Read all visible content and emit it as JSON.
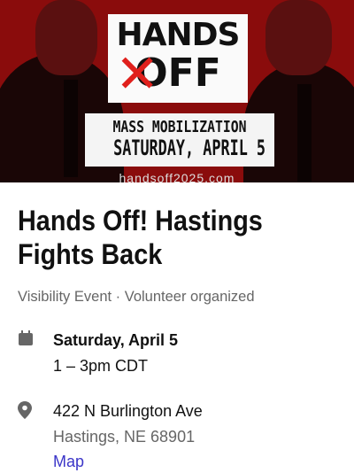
{
  "banner": {
    "heading_top": "HANDS",
    "heading_bottom": "OFF",
    "line1": "MASS MOBILIZATION",
    "line2": "SATURDAY, APRIL 5",
    "url": "handsoff2025.com"
  },
  "event": {
    "title": "Hands Off! Hastings Fights Back",
    "type": "Visibility Event",
    "separator": " · ",
    "organizer": "Volunteer organized",
    "date": "Saturday, April 5",
    "time": "1 – 3pm CDT",
    "address1": "422 N Burlington Ave",
    "address2": "Hastings, NE 68901",
    "map_link": "Map"
  },
  "icons": {
    "date": "calendar-icon",
    "location": "map-pin-icon"
  },
  "colors": {
    "banner": "#8a0c0c",
    "accent": "#e0201c",
    "link": "#3b35c8"
  }
}
